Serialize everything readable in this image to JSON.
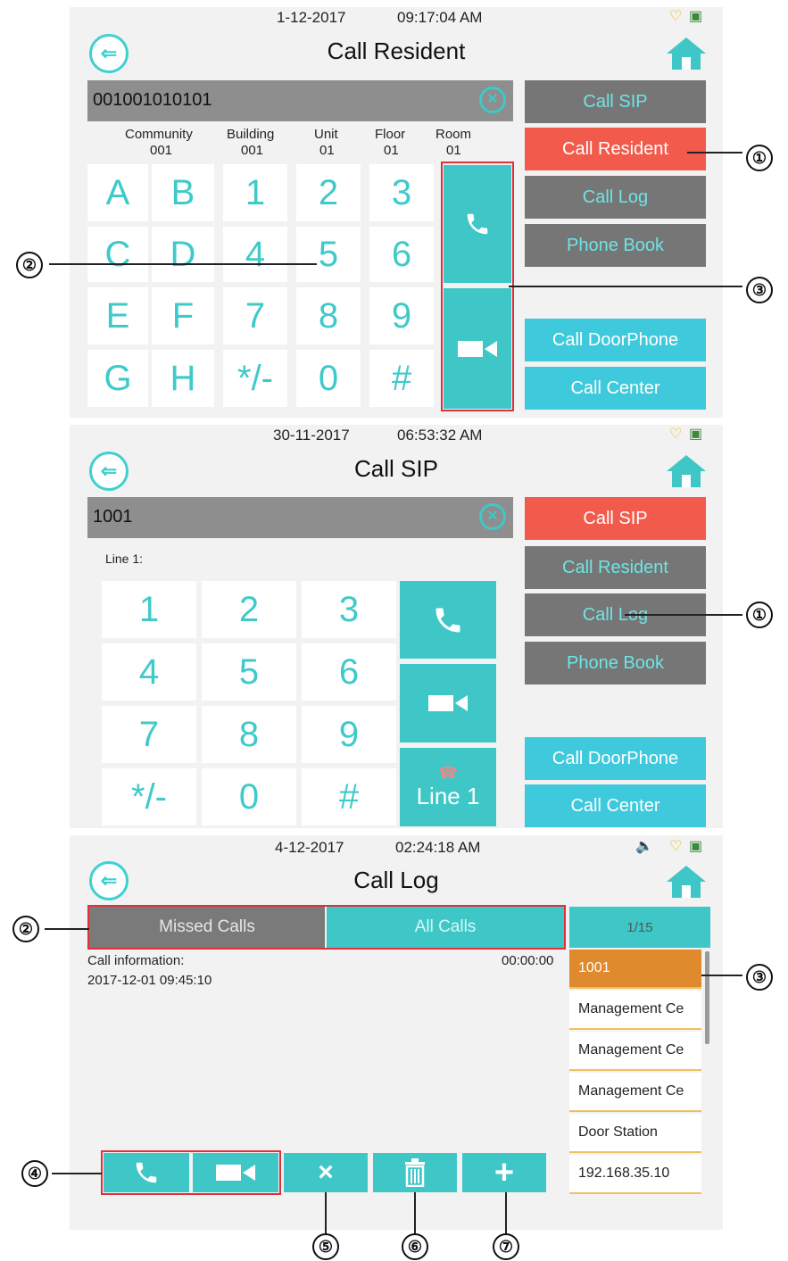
{
  "panel1": {
    "date": "1-12-2017",
    "time": "09:17:04 AM",
    "title": "Call Resident",
    "input_value": "001001010101",
    "fields": [
      {
        "label": "Community",
        "value": "001"
      },
      {
        "label": "Building",
        "value": "001"
      },
      {
        "label": "Unit",
        "value": "01"
      },
      {
        "label": "Floor",
        "value": "01"
      },
      {
        "label": "Room",
        "value": "01"
      }
    ],
    "keys": [
      "A",
      "B",
      "1",
      "2",
      "3",
      "C",
      "D",
      "4",
      "5",
      "6",
      "E",
      "F",
      "7",
      "8",
      "9",
      "G",
      "H",
      "*/-",
      "0",
      "#"
    ],
    "side": [
      "Call SIP",
      "Call Resident",
      "Call Log",
      "Phone Book",
      "Call DoorPhone",
      "Call Center"
    ]
  },
  "panel2": {
    "date": "30-11-2017",
    "time": "06:53:32 AM",
    "title": "Call SIP",
    "input_value": "1001",
    "line_label": "Line 1:",
    "keys": [
      "1",
      "2",
      "3",
      "4",
      "5",
      "6",
      "7",
      "8",
      "9",
      "*/-",
      "0",
      "#"
    ],
    "line_button": "Line 1",
    "side": [
      "Call SIP",
      "Call Resident",
      "Call Log",
      "Phone Book",
      "Call DoorPhone",
      "Call Center"
    ]
  },
  "panel3": {
    "date": "4-12-2017",
    "time": "02:24:18 AM",
    "title": "Call Log",
    "tabs": [
      "Missed Calls",
      "All Calls"
    ],
    "page": "1/15",
    "info_label": "Call information:",
    "info_duration": "00:00:00",
    "info_datetime": "2017-12-01 09:45:10",
    "list": [
      "1001",
      "Management Ce",
      "Management Ce",
      "Management Ce",
      "Door Station",
      "192.168.35.10"
    ]
  },
  "callouts": [
    "①",
    "②",
    "③",
    "①",
    "②",
    "③",
    "④",
    "⑤",
    "⑥",
    "⑦"
  ],
  "colors": {
    "teal": "#3fc7c7",
    "red": "#f25b4c",
    "gray": "#767676",
    "orange": "#e08a2e"
  }
}
